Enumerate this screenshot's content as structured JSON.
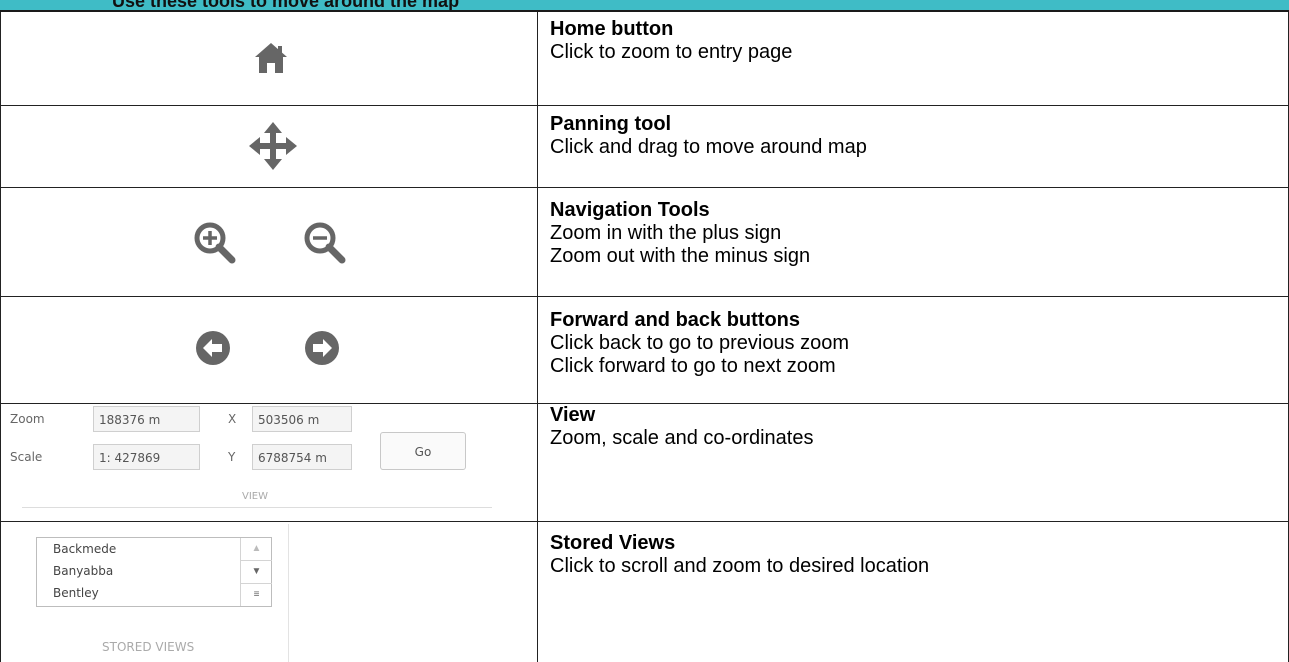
{
  "header": {
    "text": "Use these tools to move around the map"
  },
  "rows": [
    {
      "title": "Home button",
      "lines": [
        "Click to zoom to entry page"
      ]
    },
    {
      "title": "Panning tool",
      "lines": [
        "Click and drag to move around map"
      ]
    },
    {
      "title": "Navigation Tools",
      "lines": [
        "Zoom in with the plus sign",
        "Zoom out with the minus sign"
      ]
    },
    {
      "title": "Forward and back buttons",
      "lines": [
        "Click back to go to previous zoom",
        "Click forward to go to next zoom"
      ]
    },
    {
      "title": "View",
      "lines": [
        "Zoom, scale and co-ordinates"
      ]
    },
    {
      "title": "Stored Views",
      "lines": [
        "Click to scroll and zoom to desired location"
      ]
    }
  ],
  "view_widget": {
    "zoom_label": "Zoom",
    "zoom_value": "188376 m",
    "scale_label": "Scale",
    "scale_value": "1: 427869",
    "x_label": "X",
    "x_value": "503506 m",
    "y_label": "Y",
    "y_value": "6788754 m",
    "go_label": "Go",
    "caption": "VIEW"
  },
  "stored_views": {
    "items": [
      "Backmede",
      "Banyabba",
      "Bentley"
    ],
    "caption": "STORED VIEWS"
  },
  "icons": {
    "home": "home-icon",
    "pan": "pan-arrows-icon",
    "zoom_in": "zoom-in-icon",
    "zoom_out": "zoom-out-icon",
    "back": "back-arrow-icon",
    "forward": "forward-arrow-icon"
  },
  "colors": {
    "header_bg": "#3fbcc6",
    "icon_gray": "#666666"
  }
}
